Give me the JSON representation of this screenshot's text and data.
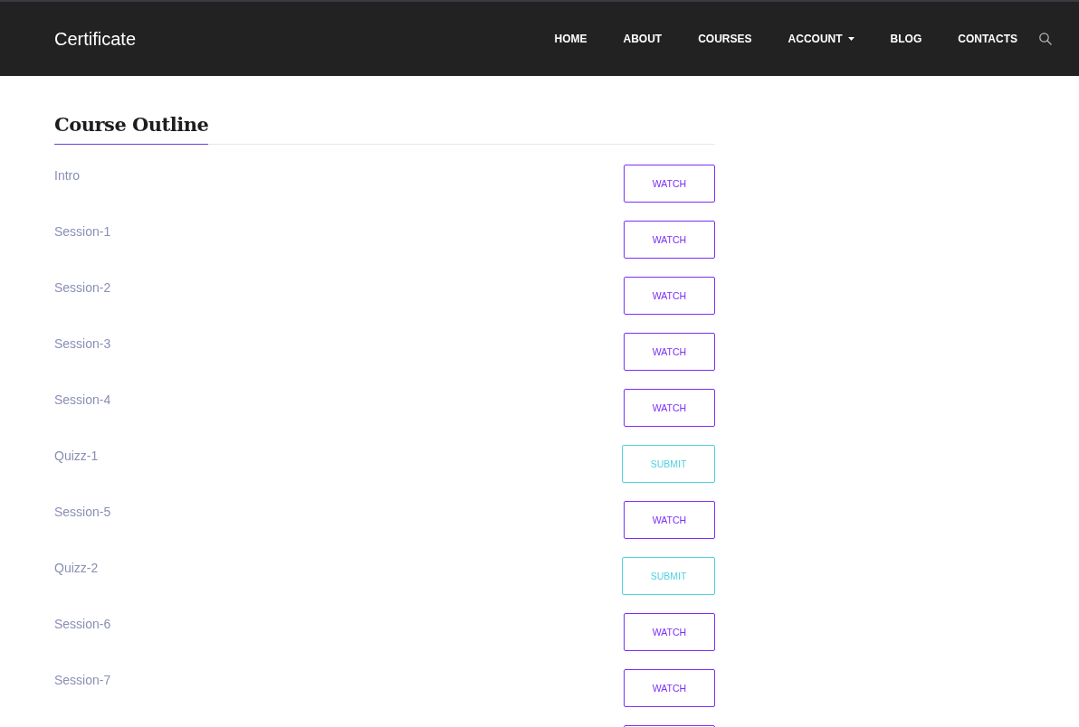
{
  "navbar": {
    "brand": "Certificate",
    "links": [
      {
        "label": "HOME",
        "dropdown": false
      },
      {
        "label": "ABOUT",
        "dropdown": false
      },
      {
        "label": "COURSES",
        "dropdown": false
      },
      {
        "label": "ACCOUNT",
        "dropdown": true
      },
      {
        "label": "BLOG",
        "dropdown": false
      },
      {
        "label": "CONTACTS",
        "dropdown": false
      }
    ]
  },
  "course_outline": {
    "title": "Course Outline",
    "items": [
      {
        "title": "Intro",
        "kind": "watch",
        "action": "WATCH"
      },
      {
        "title": "Session-1",
        "kind": "watch",
        "action": "WATCH"
      },
      {
        "title": "Session-2",
        "kind": "watch",
        "action": "WATCH"
      },
      {
        "title": "Session-3",
        "kind": "watch",
        "action": "WATCH"
      },
      {
        "title": "Session-4",
        "kind": "watch",
        "action": "WATCH"
      },
      {
        "title": "Quizz-1",
        "kind": "submit",
        "action": "SUBMIT"
      },
      {
        "title": "Session-5",
        "kind": "watch",
        "action": "WATCH"
      },
      {
        "title": "Quizz-2",
        "kind": "submit",
        "action": "SUBMIT"
      },
      {
        "title": "Session-6",
        "kind": "watch",
        "action": "WATCH"
      },
      {
        "title": "Session-7",
        "kind": "watch",
        "action": "WATCH"
      },
      {
        "kind": "watch"
      }
    ]
  }
}
